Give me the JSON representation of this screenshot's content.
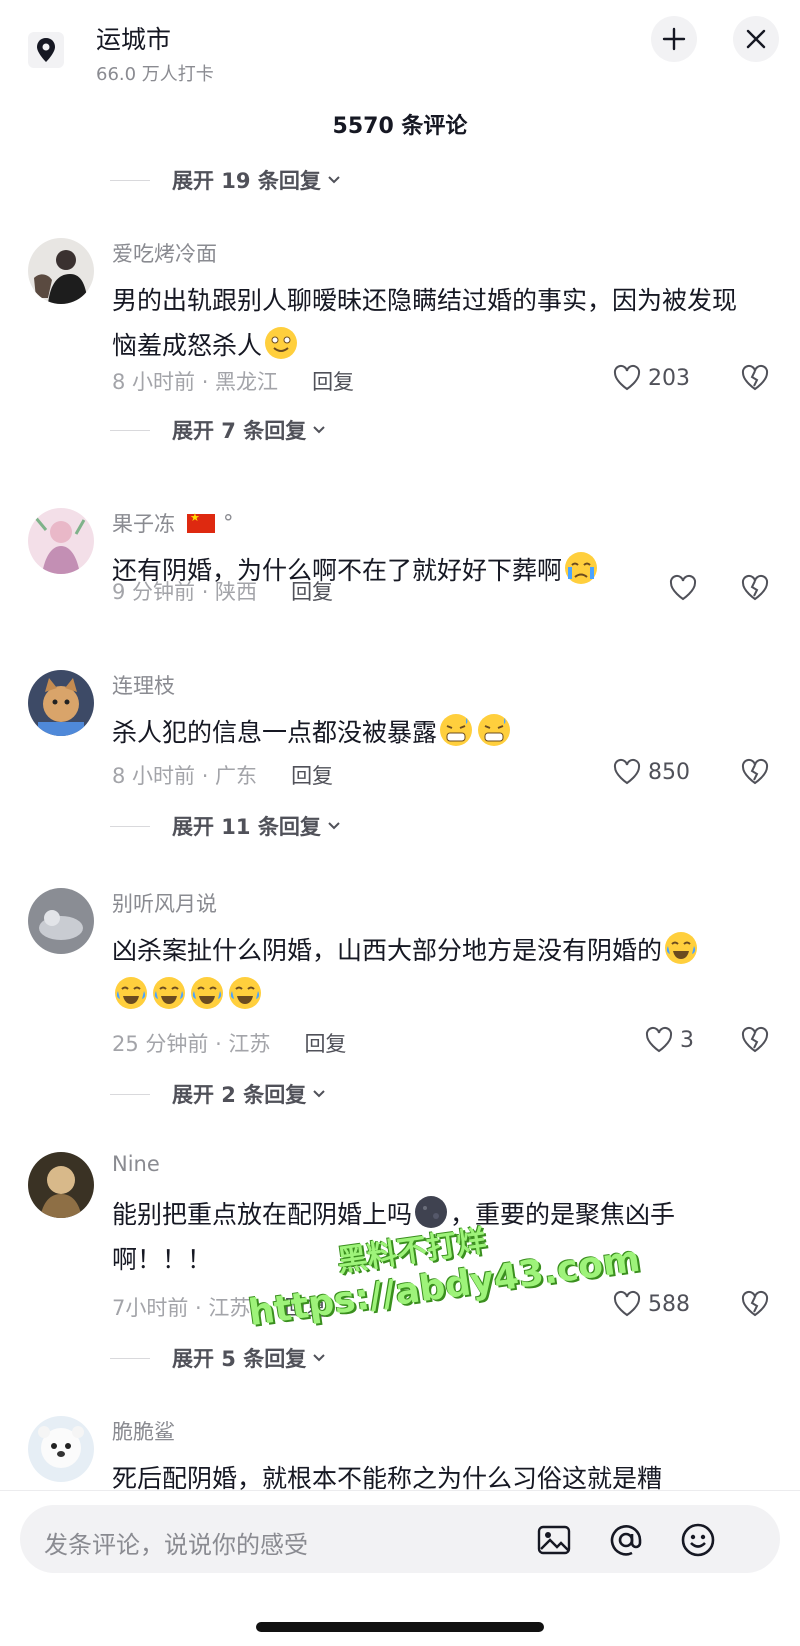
{
  "header": {
    "location": "运城市",
    "checkins": "66.0 万人打卡",
    "icons": [
      "location-pin-icon",
      "collapse-icon",
      "close-icon"
    ]
  },
  "comment_count": "5570 条评论",
  "top_expand": "展开 19 条回复",
  "comments": [
    {
      "username": "爱吃烤冷面",
      "text": "男的出轨跟别人聊暧昧还隐瞒结过婚的事实，因为被发现恼羞成怒杀人",
      "time_loc": "8 小时前 · 黑龙江",
      "reply": "回复",
      "likes": "203",
      "expand": "展开 7 条回复"
    },
    {
      "username": "果子冻",
      "username_suffix": "°",
      "text": "还有阴婚，为什么啊不在了就好好下葬啊",
      "time_loc": "9 分钟前 · 陕西",
      "reply": "回复",
      "likes": ""
    },
    {
      "username": "连理枝",
      "text": "杀人犯的信息一点都没被暴露",
      "time_loc": "8 小时前 · 广东",
      "reply": "回复",
      "likes": "850",
      "expand": "展开 11 条回复"
    },
    {
      "username": "别听风月说",
      "text": "凶杀案扯什么阴婚，山西大部分地方是没有阴婚的",
      "time_loc": "25 分钟前 · 江苏",
      "reply": "回复",
      "likes": "3",
      "expand": "展开 2 条回复"
    },
    {
      "username": "Nine",
      "text_a": "能别把重点放在配阴婚上吗",
      "text_b": "，重要的是聚焦凶手",
      "text_c": "啊！！！",
      "time_loc": "7小时前 · 江苏",
      "reply": "回复",
      "likes": "588",
      "expand": "展开 5 条回复"
    },
    {
      "username": "脆脆鲨",
      "text": "死后配阴婚，就根本不能称之为什么习俗这就是糟"
    }
  ],
  "watermark": {
    "line1": "黑料不打烊",
    "line2": "https://abdy43.com"
  },
  "input": {
    "placeholder": "发条评论，说说你的感受",
    "icons": [
      "image-icon",
      "mention-icon",
      "emoji-icon"
    ]
  },
  "colors": {
    "text": "#161823",
    "secondary": "#8a8b91",
    "watermark": "#9ef37a"
  }
}
